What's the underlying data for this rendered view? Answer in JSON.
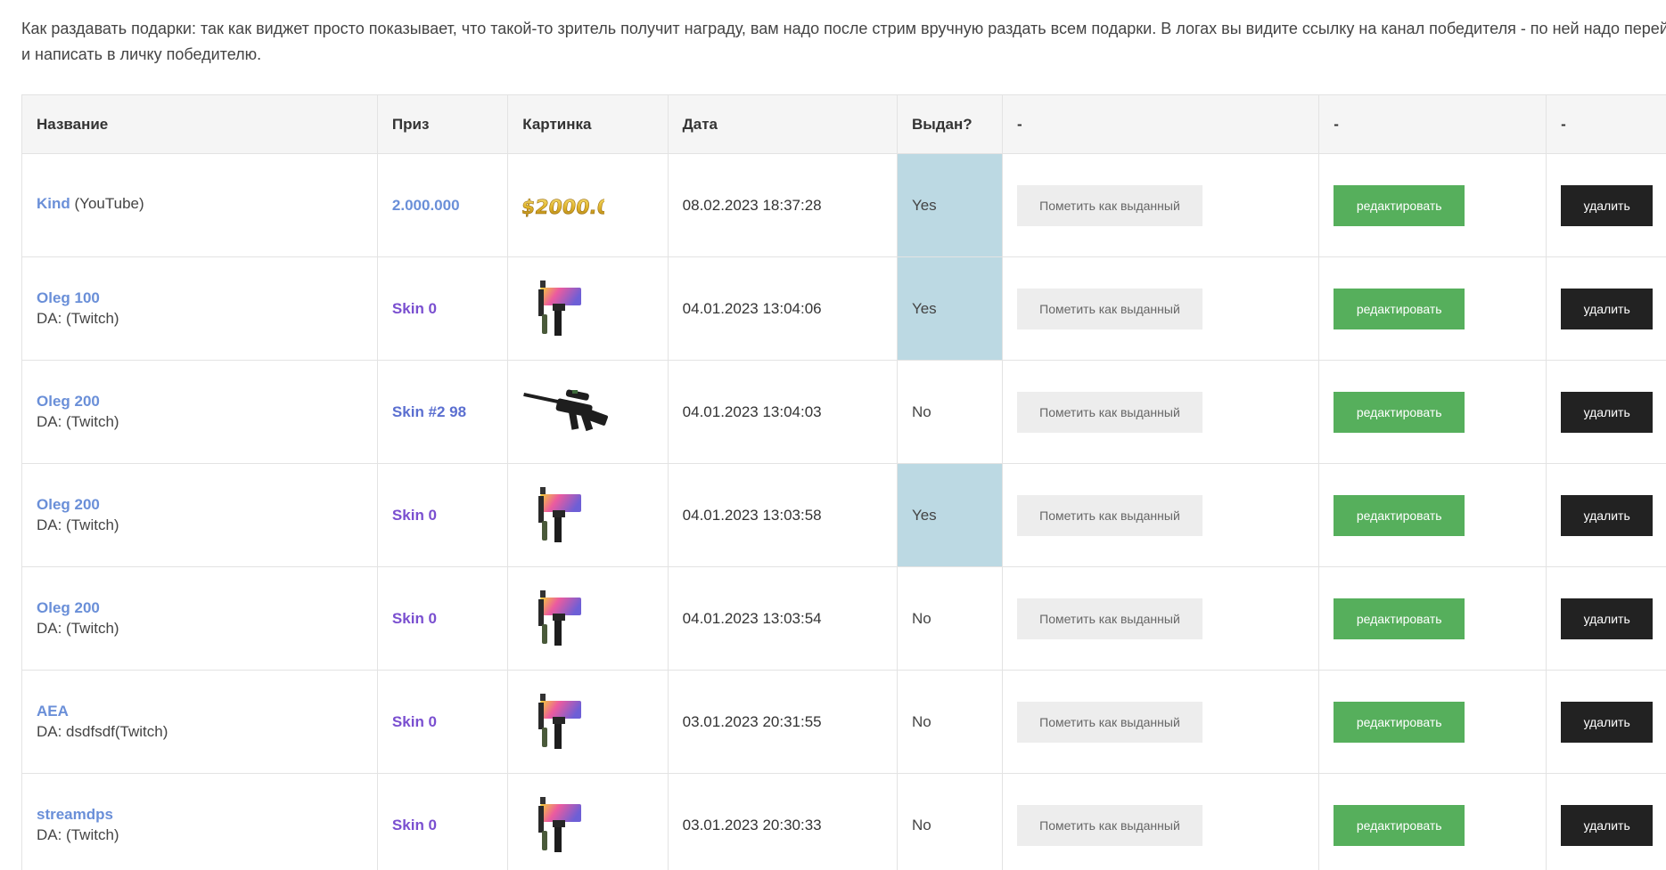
{
  "info": {
    "line1": "Как раздавать подарки: так как виджет просто показывает, что такой-то зритель получит награду, вам надо после стрим вручную раздать всем подарки. В логах вы видите ссылку на канал победителя - по ней надо перейти",
    "line2": "и написать в личку победителю."
  },
  "table": {
    "headers": [
      "Название",
      "Приз",
      "Картинка",
      "Дата",
      "Выдан?",
      "-",
      "-",
      "-"
    ]
  },
  "rows": [
    {
      "name": "Kind",
      "source": "(YouTube)",
      "sub": "",
      "prize": "2.000.000",
      "prize_color": "#6a8fd8",
      "image": "money-image",
      "date": "08.02.2023 18:37:28",
      "given": "Yes",
      "mark": "Пометить как выданный",
      "edit": "редактировать",
      "del": "удалить"
    },
    {
      "name": "Oleg 100",
      "source": "",
      "sub": "DA: (Twitch)",
      "prize": "Skin 0",
      "prize_color": "#7a4fd0",
      "image": "smg-image",
      "date": "04.01.2023 13:04:06",
      "given": "Yes",
      "mark": "Пометить как выданный",
      "edit": "редактировать",
      "del": "удалить"
    },
    {
      "name": "Oleg 200",
      "source": "",
      "sub": "DA: (Twitch)",
      "prize": "Skin #2 98",
      "prize_color": "#5b6fd0",
      "image": "rifle-image",
      "date": "04.01.2023 13:04:03",
      "given": "No",
      "mark": "Пометить как выданный",
      "edit": "редактировать",
      "del": "удалить"
    },
    {
      "name": "Oleg 200",
      "source": "",
      "sub": "DA: (Twitch)",
      "prize": "Skin 0",
      "prize_color": "#7a4fd0",
      "image": "smg-image",
      "date": "04.01.2023 13:03:58",
      "given": "Yes",
      "mark": "Пометить как выданный",
      "edit": "редактировать",
      "del": "удалить"
    },
    {
      "name": "Oleg 200",
      "source": "",
      "sub": "DA: (Twitch)",
      "prize": "Skin 0",
      "prize_color": "#7a4fd0",
      "image": "smg-image",
      "date": "04.01.2023 13:03:54",
      "given": "No",
      "mark": "Пометить как выданный",
      "edit": "редактировать",
      "del": "удалить"
    },
    {
      "name": "AEA",
      "source": "",
      "sub": "DA: dsdfsdf(Twitch)",
      "prize": "Skin 0",
      "prize_color": "#7a4fd0",
      "image": "smg-image",
      "date": "03.01.2023 20:31:55",
      "given": "No",
      "mark": "Пометить как выданный",
      "edit": "редактировать",
      "del": "удалить"
    },
    {
      "name": "streamdps",
      "source": "",
      "sub": "DA: (Twitch)",
      "prize": "Skin 0",
      "prize_color": "#7a4fd0",
      "image": "smg-image",
      "date": "03.01.2023 20:30:33",
      "given": "No",
      "mark": "Пометить как выданный",
      "edit": "редактировать",
      "del": "удалить"
    }
  ],
  "colors": {
    "given_yes_bg": "#bcd9e3",
    "edit_button": "#56af5c",
    "delete_button": "#222222",
    "mark_button": "#ededed",
    "name_link": "#6a8fd8"
  }
}
